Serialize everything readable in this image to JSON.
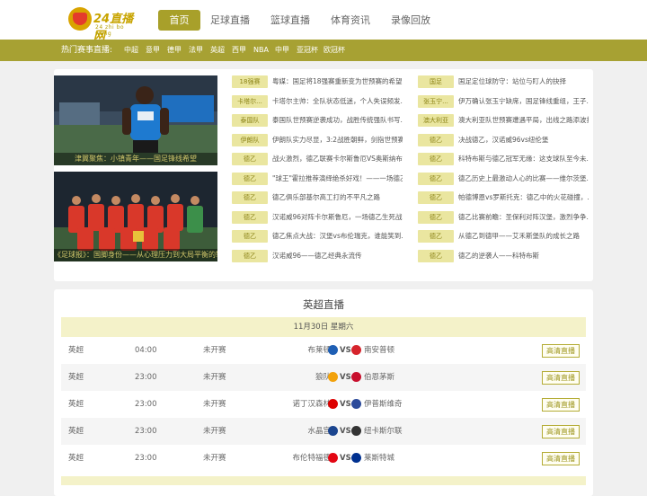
{
  "site": {
    "logo_text": "24直播网",
    "logo_sub": "24 zhi bo wang",
    "brand_color": "#a8a02a"
  },
  "nav": [
    {
      "label": "首页",
      "active": true
    },
    {
      "label": "足球直播"
    },
    {
      "label": "篮球直播"
    },
    {
      "label": "体育资讯"
    },
    {
      "label": "录像回放"
    }
  ],
  "hot": {
    "label": "热门赛事直播:",
    "items": [
      "中超",
      "意甲",
      "德甲",
      "法甲",
      "英超",
      "西甲",
      "NBA",
      "中甲",
      "亚冠杯",
      "欧冠杯"
    ]
  },
  "news": {
    "images": [
      {
        "caption": "津翼聚焦：小镇青年——国足锋线希望"
      },
      {
        "caption": "《足球报》：国脚身份——从心理压力到大局平衡的较量"
      }
    ],
    "left": [
      {
        "tag": "18强赛",
        "title": "粤媒：国足将18强赛重新变为世预赛的希望..."
      },
      {
        "tag": "卡塔尔...",
        "title": "卡塔尔主帅：全队状态低迷，个人失误频发..."
      },
      {
        "tag": "泰国队",
        "title": "泰国队世预赛逆袭成功，战胜传统强队书写..."
      },
      {
        "tag": "伊朗队",
        "title": "伊朗队实力尽显，3:2战胜朝鲜，剑指世预赛..."
      },
      {
        "tag": "德乙",
        "title": "战火激烈，德乙联赛卡尔斯鲁厄VS奥斯纳布..."
      },
      {
        "tag": "德乙",
        "title": "\"球王\"霍拉推荐演绎绝杀好戏！——一场德乙..."
      },
      {
        "tag": "德乙",
        "title": "德乙俱乐部基尔高工打的不平凡之路"
      },
      {
        "tag": "德乙",
        "title": "汉诺威96对阵卡尔斯鲁厄，一场德乙生死战!"
      },
      {
        "tag": "德乙",
        "title": "德乙焦点大战：汉堡vs布伦瑞克，谁能笑到..."
      },
      {
        "tag": "德乙",
        "title": "汉诺威96——德乙经典永流传"
      }
    ],
    "right": [
      {
        "tag": "国足",
        "title": "国足定位球防守：站位与盯人的抉择"
      },
      {
        "tag": "张玉宁...",
        "title": "伊万确认张玉宁缺席，国足锋线重组，王子..."
      },
      {
        "tag": "澳大利亚",
        "title": "澳大利亚队世预赛遭遇平局，出线之路添波折"
      },
      {
        "tag": "德乙",
        "title": "决战德乙，汉诺威96vs纽伦堡"
      },
      {
        "tag": "德乙",
        "title": "科特布斯与德乙冠军无缘：这支球队至今未..."
      },
      {
        "tag": "德乙",
        "title": "德乙历史上最激动人心的比赛——维尔茨堡..."
      },
      {
        "tag": "德乙",
        "title": "帕德博恩vs罗斯托克：德乙中的火花碰撞，..."
      },
      {
        "tag": "德乙",
        "title": "德乙比赛前瞻：圣保利对阵汉堡，激烈争争..."
      },
      {
        "tag": "德乙",
        "title": "从德乙到德甲——艾禾斯堡队的成长之路"
      },
      {
        "tag": "德乙",
        "title": "德乙的逆袭人——科特布斯"
      }
    ]
  },
  "schedule": {
    "title": "英超直播",
    "date": "11月30日 星期六",
    "vs": "VS",
    "matches": [
      {
        "league": "英超",
        "time": "04:00",
        "status": "未开赛",
        "home": "布莱顿",
        "away": "南安普顿",
        "home_color": "#1f5fb4",
        "away_color": "#d6242c",
        "button": "高清直播"
      },
      {
        "league": "英超",
        "time": "23:00",
        "status": "未开赛",
        "home": "狼队",
        "away": "伯恩茅斯",
        "home_color": "#f2a20c",
        "away_color": "#c8102e",
        "button": "高清直播"
      },
      {
        "league": "英超",
        "time": "23:00",
        "status": "未开赛",
        "home": "诺丁汉森林",
        "away": "伊普斯维奇",
        "home_color": "#dd0000",
        "away_color": "#2b4a9a",
        "button": "高清直播"
      },
      {
        "league": "英超",
        "time": "23:00",
        "status": "未开赛",
        "home": "水晶宫",
        "away": "纽卡斯尔联",
        "home_color": "#1b458f",
        "away_color": "#333333",
        "button": "高清直播"
      },
      {
        "league": "英超",
        "time": "23:00",
        "status": "未开赛",
        "home": "布伦特福德",
        "away": "莱斯特城",
        "home_color": "#e30613",
        "away_color": "#003090",
        "button": "高清直播"
      }
    ]
  }
}
